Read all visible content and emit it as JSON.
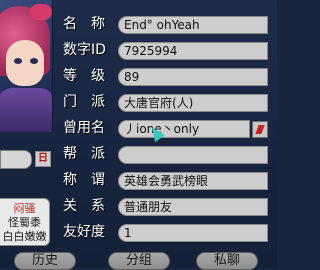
{
  "rows": [
    {
      "key": "name",
      "label": "名　称",
      "value": "End° ohYeah"
    },
    {
      "key": "id",
      "label": "数字ID",
      "value": "7925994"
    },
    {
      "key": "level",
      "label": "等　级",
      "value": "89"
    },
    {
      "key": "sect",
      "label": "门　派",
      "value": "大唐官府(人)"
    },
    {
      "key": "former_name",
      "label": "曾用名",
      "value": "丿ione丶only"
    },
    {
      "key": "guild",
      "label": "帮　派",
      "value": ""
    },
    {
      "key": "title",
      "label": "称　谓",
      "value": "英雄会勇武榜眼"
    },
    {
      "key": "relation",
      "label": "关　系",
      "value": "普通朋友"
    },
    {
      "key": "friendship",
      "label": "友好度",
      "value": "1"
    }
  ],
  "left_card": {
    "line1": "闷骚",
    "line2": "怪蜀黍",
    "line3": "白白嫩嫩"
  },
  "calendar_button_label": "日",
  "buttons": {
    "history": "历史",
    "group": "分组",
    "private_chat": "私聊"
  },
  "icons": {
    "dropdown": "dropdown-icon",
    "cursor": "cursor-icon",
    "portrait": "portrait-avatar"
  }
}
